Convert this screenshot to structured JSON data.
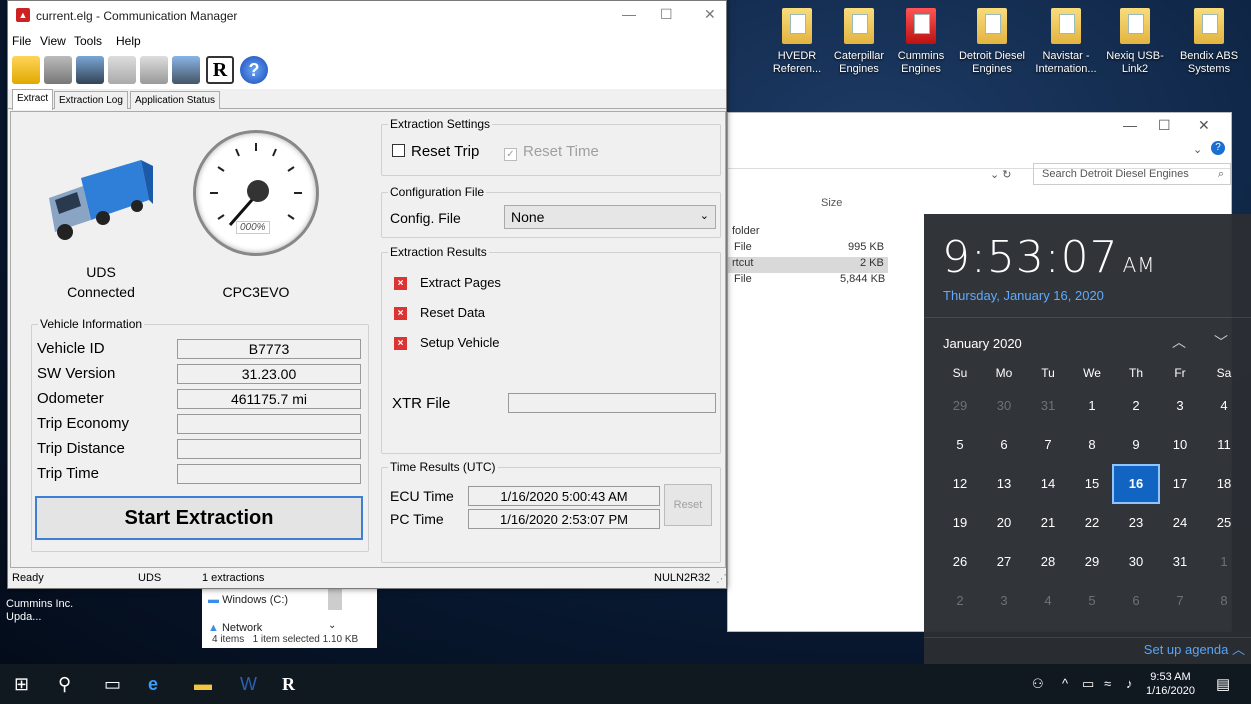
{
  "desktop": {
    "icons": [
      {
        "label": "HVEDR Referen..."
      },
      {
        "label": "Caterpillar Engines"
      },
      {
        "label": "Cummins Engines"
      },
      {
        "label": "Detroit Diesel Engines"
      },
      {
        "label": "Navistar - Internation..."
      },
      {
        "label": "Nexiq USB-Link2"
      },
      {
        "label": "Bendix ABS Systems"
      }
    ],
    "left_icon": "Cummins Inc. Upda..."
  },
  "explorer": {
    "search_placeholder": "Search Detroit Diesel Engines",
    "size_header": "Size",
    "rows": [
      {
        "type": "folder",
        "size": ""
      },
      {
        "type": "File",
        "size": "995 KB"
      },
      {
        "type": "rtcut",
        "size": "2 KB"
      },
      {
        "type": "File",
        "size": "5,844 KB"
      }
    ],
    "nav_windows": "Windows (C:)",
    "nav_network": "Network",
    "status_items": "4 items",
    "status_selected": "1 item selected  1.10 KB"
  },
  "calendar": {
    "time": "9:53:07",
    "ampm": "AM",
    "date": "Thursday, January 16, 2020",
    "month": "January 2020",
    "dows": [
      "Su",
      "Mo",
      "Tu",
      "We",
      "Th",
      "Fr",
      "Sa"
    ],
    "days": [
      "29",
      "30",
      "31",
      "1",
      "2",
      "3",
      "4",
      "5",
      "6",
      "7",
      "8",
      "9",
      "10",
      "11",
      "12",
      "13",
      "14",
      "15",
      "16",
      "17",
      "18",
      "19",
      "20",
      "21",
      "22",
      "23",
      "24",
      "25",
      "26",
      "27",
      "28",
      "29",
      "30",
      "31",
      "1",
      "2",
      "3",
      "4",
      "5",
      "6",
      "7",
      "8"
    ],
    "dim_flags": [
      1,
      1,
      1,
      0,
      0,
      0,
      0,
      0,
      0,
      0,
      0,
      0,
      0,
      0,
      0,
      0,
      0,
      0,
      0,
      0,
      0,
      0,
      0,
      0,
      0,
      0,
      0,
      0,
      0,
      0,
      0,
      0,
      0,
      0,
      1,
      1,
      1,
      1,
      1,
      1,
      1,
      1
    ],
    "today_index": 18,
    "agenda": "Set up agenda"
  },
  "cm": {
    "title": "current.elg - Communication Manager",
    "menu": [
      "File",
      "View",
      "Tools",
      "Help"
    ],
    "tabs": [
      "Extract",
      "Extraction Log",
      "Application Status"
    ],
    "connection_status_1": "UDS",
    "connection_status_2": "Connected",
    "ecu_name": "CPC3EVO",
    "gauge_readout": "000%",
    "vehicle_info_title": "Vehicle Information",
    "vehicle_fields": [
      {
        "label": "Vehicle ID",
        "value": "B7773"
      },
      {
        "label": "SW Version",
        "value": "31.23.00"
      },
      {
        "label": "Odometer",
        "value": "461175.7 mi"
      },
      {
        "label": "Trip Economy",
        "value": ""
      },
      {
        "label": "Trip Distance",
        "value": ""
      },
      {
        "label": "Trip Time",
        "value": ""
      }
    ],
    "start_button": "Start Extraction",
    "extraction_settings_title": "Extraction Settings",
    "reset_trip": "Reset Trip",
    "reset_time": "Reset Time",
    "config_title": "Configuration File",
    "config_label": "Config. File",
    "config_value": "None",
    "results_title": "Extraction Results",
    "results": [
      "Extract Pages",
      "Reset Data",
      "Setup Vehicle"
    ],
    "xtr_label": "XTR File",
    "xtr_value": "",
    "time_title": "Time Results (UTC)",
    "ecu_time_label": "ECU Time",
    "ecu_time_value": "1/16/2020 5:00:43 AM",
    "pc_time_label": "PC Time",
    "pc_time_value": "1/16/2020 2:53:07 PM",
    "reset_button": "Reset",
    "status_ready": "Ready",
    "status_protocol": "UDS",
    "status_count": "1 extractions",
    "status_id": "NULN2R32"
  },
  "taskbar": {
    "clock_time": "9:53 AM",
    "clock_date": "1/16/2020"
  }
}
